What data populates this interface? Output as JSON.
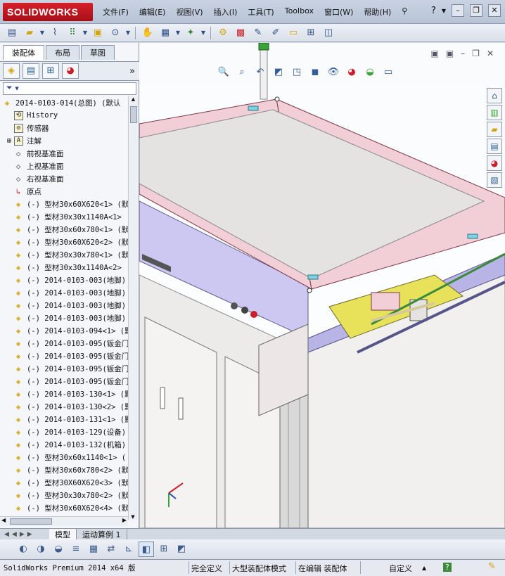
{
  "app": {
    "logo": "SOLIDWORKS",
    "menus": [
      "文件(F)",
      "编辑(E)",
      "视图(V)",
      "插入(I)",
      "工具(T)",
      "Toolbox",
      "窗口(W)",
      "帮助(H)"
    ],
    "help_label": "?"
  },
  "panel": {
    "tabs": [
      "装配体",
      "布局",
      "草图"
    ],
    "expand_glyph": "»",
    "filter_glyph": "▼"
  },
  "tree": {
    "root": "2014-0103-014(总图)  (默认",
    "items": [
      {
        "icon": "history-icon",
        "label": "History"
      },
      {
        "icon": "sensor-icon",
        "label": "传感器"
      },
      {
        "icon": "annotation-icon",
        "label": "注解",
        "expandable": true
      },
      {
        "icon": "plane-icon",
        "label": "前视基准面"
      },
      {
        "icon": "plane-icon",
        "label": "上视基准面"
      },
      {
        "icon": "plane-icon",
        "label": "右视基准面"
      },
      {
        "icon": "origin-icon",
        "label": "原点"
      },
      {
        "icon": "part-icon",
        "label": "(-) 型材30x60X620<1> (默"
      },
      {
        "icon": "part-icon",
        "label": "(-) 型材30x30x1140A<1>"
      },
      {
        "icon": "part-icon",
        "label": "(-) 型材30x60x780<1> (默"
      },
      {
        "icon": "part-icon",
        "label": "(-) 型材30x60X620<2> (默"
      },
      {
        "icon": "part-icon",
        "label": "(-) 型材30x30x780<1> (默"
      },
      {
        "icon": "part-icon",
        "label": "(-) 型材30x30x1140A<2>"
      },
      {
        "icon": "part-icon",
        "label": "(-) 2014-0103-003(地脚)"
      },
      {
        "icon": "part-icon",
        "label": "(-) 2014-0103-003(地脚)"
      },
      {
        "icon": "part-icon",
        "label": "(-) 2014-0103-003(地脚)"
      },
      {
        "icon": "part-icon",
        "label": "(-) 2014-0103-003(地脚)"
      },
      {
        "icon": "part-icon",
        "label": "(-) 2014-0103-094<1> (默"
      },
      {
        "icon": "part-icon",
        "label": "(-) 2014-0103-095(钣金门"
      },
      {
        "icon": "part-icon",
        "label": "(-) 2014-0103-095(钣金门"
      },
      {
        "icon": "part-icon",
        "label": "(-) 2014-0103-095(钣金门"
      },
      {
        "icon": "part-icon",
        "label": "(-) 2014-0103-095(钣金门"
      },
      {
        "icon": "part-icon",
        "label": "(-) 2014-0103-130<1> (默"
      },
      {
        "icon": "part-icon",
        "label": "(-) 2014-0103-130<2> (默"
      },
      {
        "icon": "part-icon",
        "label": "(-) 2014-0103-131<1> (默"
      },
      {
        "icon": "part-icon",
        "label": "(-) 2014-0103-129(设备)"
      },
      {
        "icon": "part-icon",
        "label": "(-) 2014-0103-132(机箱)"
      },
      {
        "icon": "part-icon",
        "label": "(-) 型材30x60x1140<1> ("
      },
      {
        "icon": "part-icon",
        "label": "(-) 型材30x60x780<2> (默"
      },
      {
        "icon": "part-icon",
        "label": "(-) 型材30X60X620<3> (默"
      },
      {
        "icon": "part-icon",
        "label": "(-) 型材30x30x780<2> (默"
      },
      {
        "icon": "part-icon",
        "label": "(-) 型材30x60X620<4> (默"
      }
    ]
  },
  "bottom_tabs": [
    "模型",
    "运动算例 1"
  ],
  "status": {
    "product": "SolidWorks Premium 2014 x64 版",
    "state": "完全定义",
    "mode": "大型装配体模式",
    "editing": "在编辑 装配体",
    "units": "自定义",
    "help": "?"
  },
  "colors": {
    "panel_bg": "#f5f6f9",
    "frame": "#b7c3d6",
    "accent_red": "#c8202a",
    "part_lavender": "#cdc8f2",
    "part_pink": "#f2cfd6",
    "part_gray": "#e5e3e1"
  }
}
